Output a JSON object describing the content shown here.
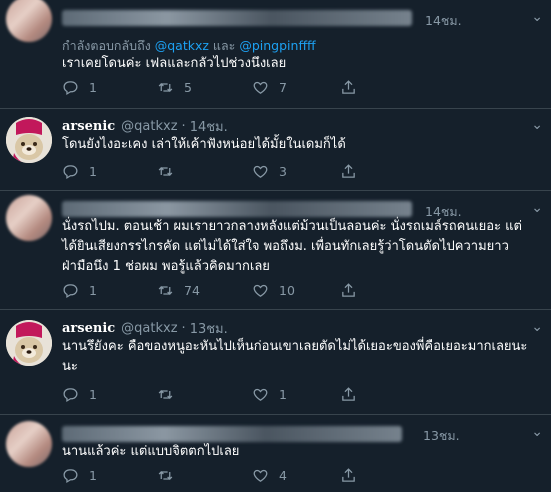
{
  "tweets": [
    {
      "time": "14ชม.",
      "reply_prefix": "กำลังตอบกลับถึง",
      "reply_mention1": "@qatkxz",
      "reply_and": "และ",
      "reply_mention2": "@pingpinffff",
      "text": "เราเคยโดนค่ะ เฟลและกลัวไปช่วงนึงเลย",
      "reply_count": "1",
      "retweet_count": "5",
      "like_count": "7"
    },
    {
      "name": "arsenic",
      "handle": "@qatkxz",
      "dot": "·",
      "time": "14ชม.",
      "text": "โดนยังไงอะเคง เล่าให้เค้าฟังหน่อยได้มั้ยในเดมก็ได้",
      "reply_count": "1",
      "retweet_count": "",
      "like_count": "3"
    },
    {
      "time": "14ชม.",
      "text_line1": "นั่งรถไปม. ตอนเช้า ผมเรายาวกลางหลังแต่ม้วนเป็นลอนค่ะ นั่งรถเมล์รถคนเยอะ แต่",
      "text_line2": "ได้ยินเสียงกรรไกรคัด แต่ไม่ได้ใส่ใจ พอถึงม. เพื่อนทักเลยรู้ว่าโดนตัดไปความยาว",
      "text_line3": "ฝ่ามือนึง 1 ช่อผม พอรู้แล้วคิดมากเลย",
      "reply_count": "1",
      "retweet_count": "74",
      "like_count": "10"
    },
    {
      "name": "arsenic",
      "handle": "@qatkxz",
      "dot": "·",
      "time": "13ชม.",
      "text_line1": "นานรึยังคะ คือของหนูอะหันไปเห็นก่อนเขาเลยตัดไม่ได้เยอะของพี่คือเยอะมากเลยนะ",
      "text_line2": "นะ",
      "reply_count": "1",
      "retweet_count": "",
      "like_count": "1"
    },
    {
      "time": "13ชม.",
      "text": "นานแล้วค่ะ แต่แบบจิตตกไปเลย",
      "reply_count": "1",
      "retweet_count": "",
      "like_count": "4"
    }
  ],
  "icons": {
    "reply": "reply-icon",
    "retweet": "retweet-icon",
    "like": "heart-icon",
    "share": "share-icon",
    "more": "chevron-down-icon"
  },
  "colors": {
    "background": "#15202b",
    "muted": "#8899a6",
    "accent": "#1da1f2",
    "divider": "#38444d"
  }
}
